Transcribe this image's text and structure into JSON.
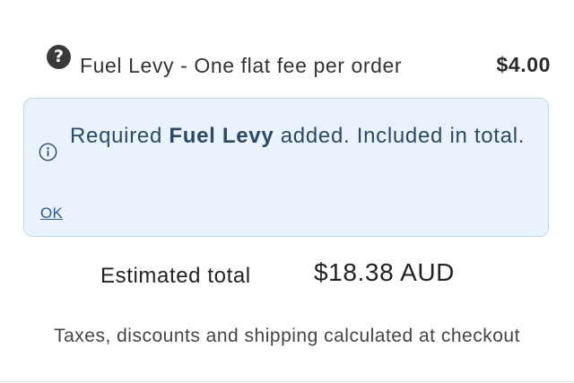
{
  "fee": {
    "help_icon_glyph": "?",
    "label": "Fuel Levy - One flat fee per order",
    "price": "$4.00"
  },
  "notice": {
    "icon": "info-icon",
    "text_prefix": "Required ",
    "text_strong": "Fuel Levy",
    "text_suffix": " added. Included in total.",
    "ok_label": "OK"
  },
  "summary": {
    "total_label": "Estimated total",
    "total_value": "$18.38 AUD",
    "tax_note": "Taxes, discounts and shipping calculated at checkout"
  },
  "colors": {
    "notice_background": "#eaf2fb",
    "notice_border": "#c2d6ea",
    "notice_text": "#2c4a66",
    "link": "#2c5a8a"
  }
}
